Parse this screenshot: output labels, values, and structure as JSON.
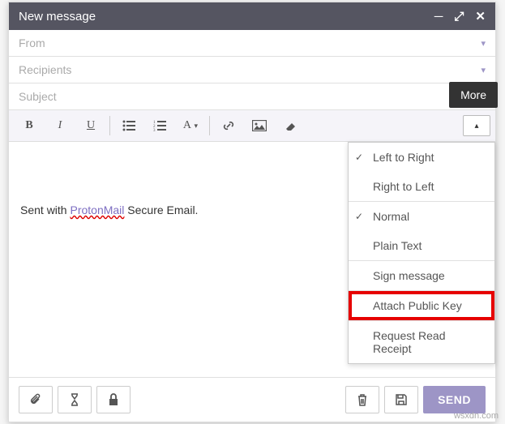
{
  "window": {
    "title": "New message",
    "more_tooltip": "More"
  },
  "fields": {
    "from": "From",
    "recipients": "Recipients",
    "subject": "Subject"
  },
  "body": {
    "prefix": "Sent with ",
    "link_text": "ProtonMail",
    "suffix": " Secure Email."
  },
  "dropdown": {
    "ltr": "Left to Right",
    "rtl": "Right to Left",
    "normal": "Normal",
    "plain": "Plain Text",
    "sign": "Sign message",
    "attach_pk": "Attach Public Key",
    "read_receipt": "Request Read Receipt"
  },
  "footer": {
    "send": "SEND"
  },
  "watermark": "wsxdn.com"
}
